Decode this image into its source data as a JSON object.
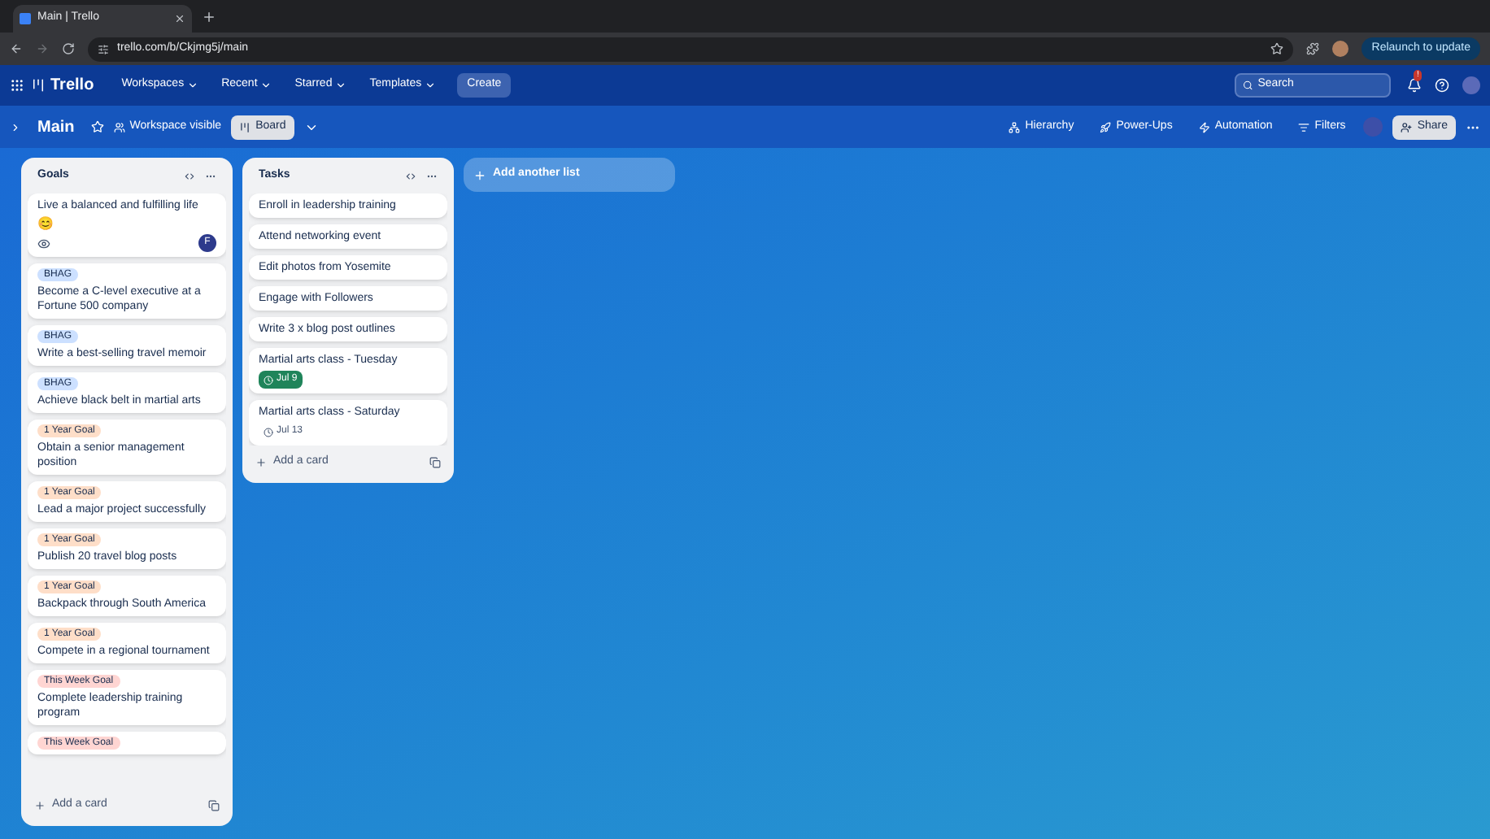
{
  "browser": {
    "tab_title": "Main | Trello",
    "url": "trello.com/b/Ckjmg5j/main",
    "relaunch": "Relaunch to update"
  },
  "header": {
    "logo": "Trello",
    "menus": [
      "Workspaces",
      "Recent",
      "Starred",
      "Templates"
    ],
    "create": "Create",
    "search": {
      "placeholder": "Search"
    },
    "notification_count": "!"
  },
  "board_bar": {
    "title": "Main",
    "visibility": "Workspace visible",
    "view": "Board",
    "actions": [
      "Hierarchy",
      "Power-Ups",
      "Automation",
      "Filters"
    ],
    "share": "Share"
  },
  "lists": [
    {
      "title": "Goals",
      "cards": [
        {
          "title": "Live a balanced and fulfilling life",
          "emoji": "😊",
          "watched": true,
          "member": "F"
        },
        {
          "label": {
            "text": "BHAG",
            "color": "#cce0ff"
          },
          "title": "Become a C-level executive at a Fortune 500 company"
        },
        {
          "label": {
            "text": "BHAG",
            "color": "#cce0ff"
          },
          "title": "Write a best-selling travel memoir"
        },
        {
          "label": {
            "text": "BHAG",
            "color": "#cce0ff"
          },
          "title": "Achieve black belt in martial arts"
        },
        {
          "label": {
            "text": "1 Year Goal",
            "color": "#fedec8"
          },
          "title": "Obtain a senior management position"
        },
        {
          "label": {
            "text": "1 Year Goal",
            "color": "#fedec8"
          },
          "title": "Lead a major project successfully"
        },
        {
          "label": {
            "text": "1 Year Goal",
            "color": "#fedec8"
          },
          "title": "Publish 20 travel blog posts"
        },
        {
          "label": {
            "text": "1 Year Goal",
            "color": "#fedec8"
          },
          "title": "Backpack through South America"
        },
        {
          "label": {
            "text": "1 Year Goal",
            "color": "#fedec8"
          },
          "title": "Compete in a regional tournament"
        },
        {
          "label": {
            "text": "This Week Goal",
            "color": "#ffd5d2"
          },
          "title": "Complete leadership training program"
        },
        {
          "label": {
            "text": "This Week Goal",
            "color": "#ffd5d2"
          }
        }
      ],
      "add_card": "Add a card"
    },
    {
      "title": "Tasks",
      "cards": [
        {
          "title": "Enroll in leadership training"
        },
        {
          "title": "Attend networking event"
        },
        {
          "title": "Edit photos from Yosemite"
        },
        {
          "title": "Engage with Followers"
        },
        {
          "title": "Write 3 x blog post outlines"
        },
        {
          "title": "Martial arts class - Tuesday",
          "due": {
            "text": "Jul 9",
            "complete": true
          }
        },
        {
          "title": "Martial arts class - Saturday",
          "due": {
            "text": "Jul 13",
            "complete": false
          }
        }
      ],
      "add_card": "Add a card"
    }
  ],
  "add_list": "Add another list"
}
